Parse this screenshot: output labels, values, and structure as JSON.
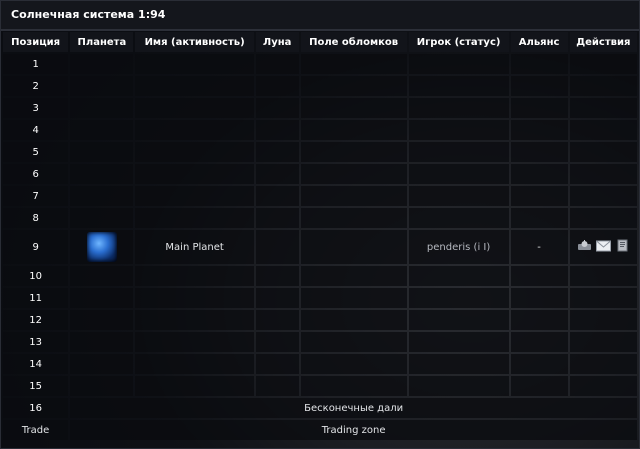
{
  "title": "Солнечная система 1:94",
  "headers": [
    "Позиция",
    "Планета",
    "Имя (активность)",
    "Луна",
    "Поле обломков",
    "Игрок (статус)",
    "Альянс",
    "Действия"
  ],
  "rows": [
    {
      "pos": "1"
    },
    {
      "pos": "2"
    },
    {
      "pos": "3"
    },
    {
      "pos": "4"
    },
    {
      "pos": "5"
    },
    {
      "pos": "6"
    },
    {
      "pos": "7"
    },
    {
      "pos": "8"
    },
    {
      "pos": "9",
      "planet_name": "Main Planet",
      "player": "penderis (i I)",
      "alliance": "-"
    },
    {
      "pos": "10"
    },
    {
      "pos": "11"
    },
    {
      "pos": "12"
    },
    {
      "pos": "13"
    },
    {
      "pos": "14"
    },
    {
      "pos": "15"
    }
  ],
  "row16": {
    "pos": "16",
    "text": "Бесконечные дали"
  },
  "trade": {
    "pos": "Trade",
    "text": "Trading zone"
  },
  "icons": {
    "spy": "spy-probe-icon",
    "message": "envelope-icon",
    "buddy": "buddy-request-icon"
  },
  "colors": {
    "background": "#0b0d12",
    "header": "#12141a",
    "planet_blue": "#2a6ed0"
  }
}
